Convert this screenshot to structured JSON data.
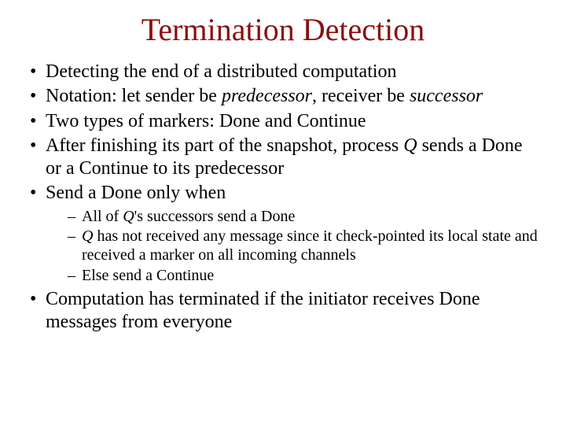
{
  "title": "Termination Detection",
  "b1": "Detecting the end of a distributed computation",
  "b2": {
    "a": "Notation: let sender be ",
    "b": "predecessor",
    "c": ", receiver be ",
    "d": "successor"
  },
  "b3": "Two types of markers: Done and Continue",
  "b4": {
    "a": "After finishing its part of the snapshot, process ",
    "b": "Q",
    "c": " sends a Done or a Continue to its predecessor"
  },
  "b5": "Send a Done only when",
  "s1": {
    "a": "All of ",
    "b": "Q",
    "c": "'s successors send a Done"
  },
  "s2": {
    "a": "Q",
    "b": " has not received any message since it check-pointed its local state and received a marker on all incoming channels"
  },
  "s3": "Else send a Continue",
  "b6": "Computation has terminated if the initiator receives Done messages from everyone"
}
